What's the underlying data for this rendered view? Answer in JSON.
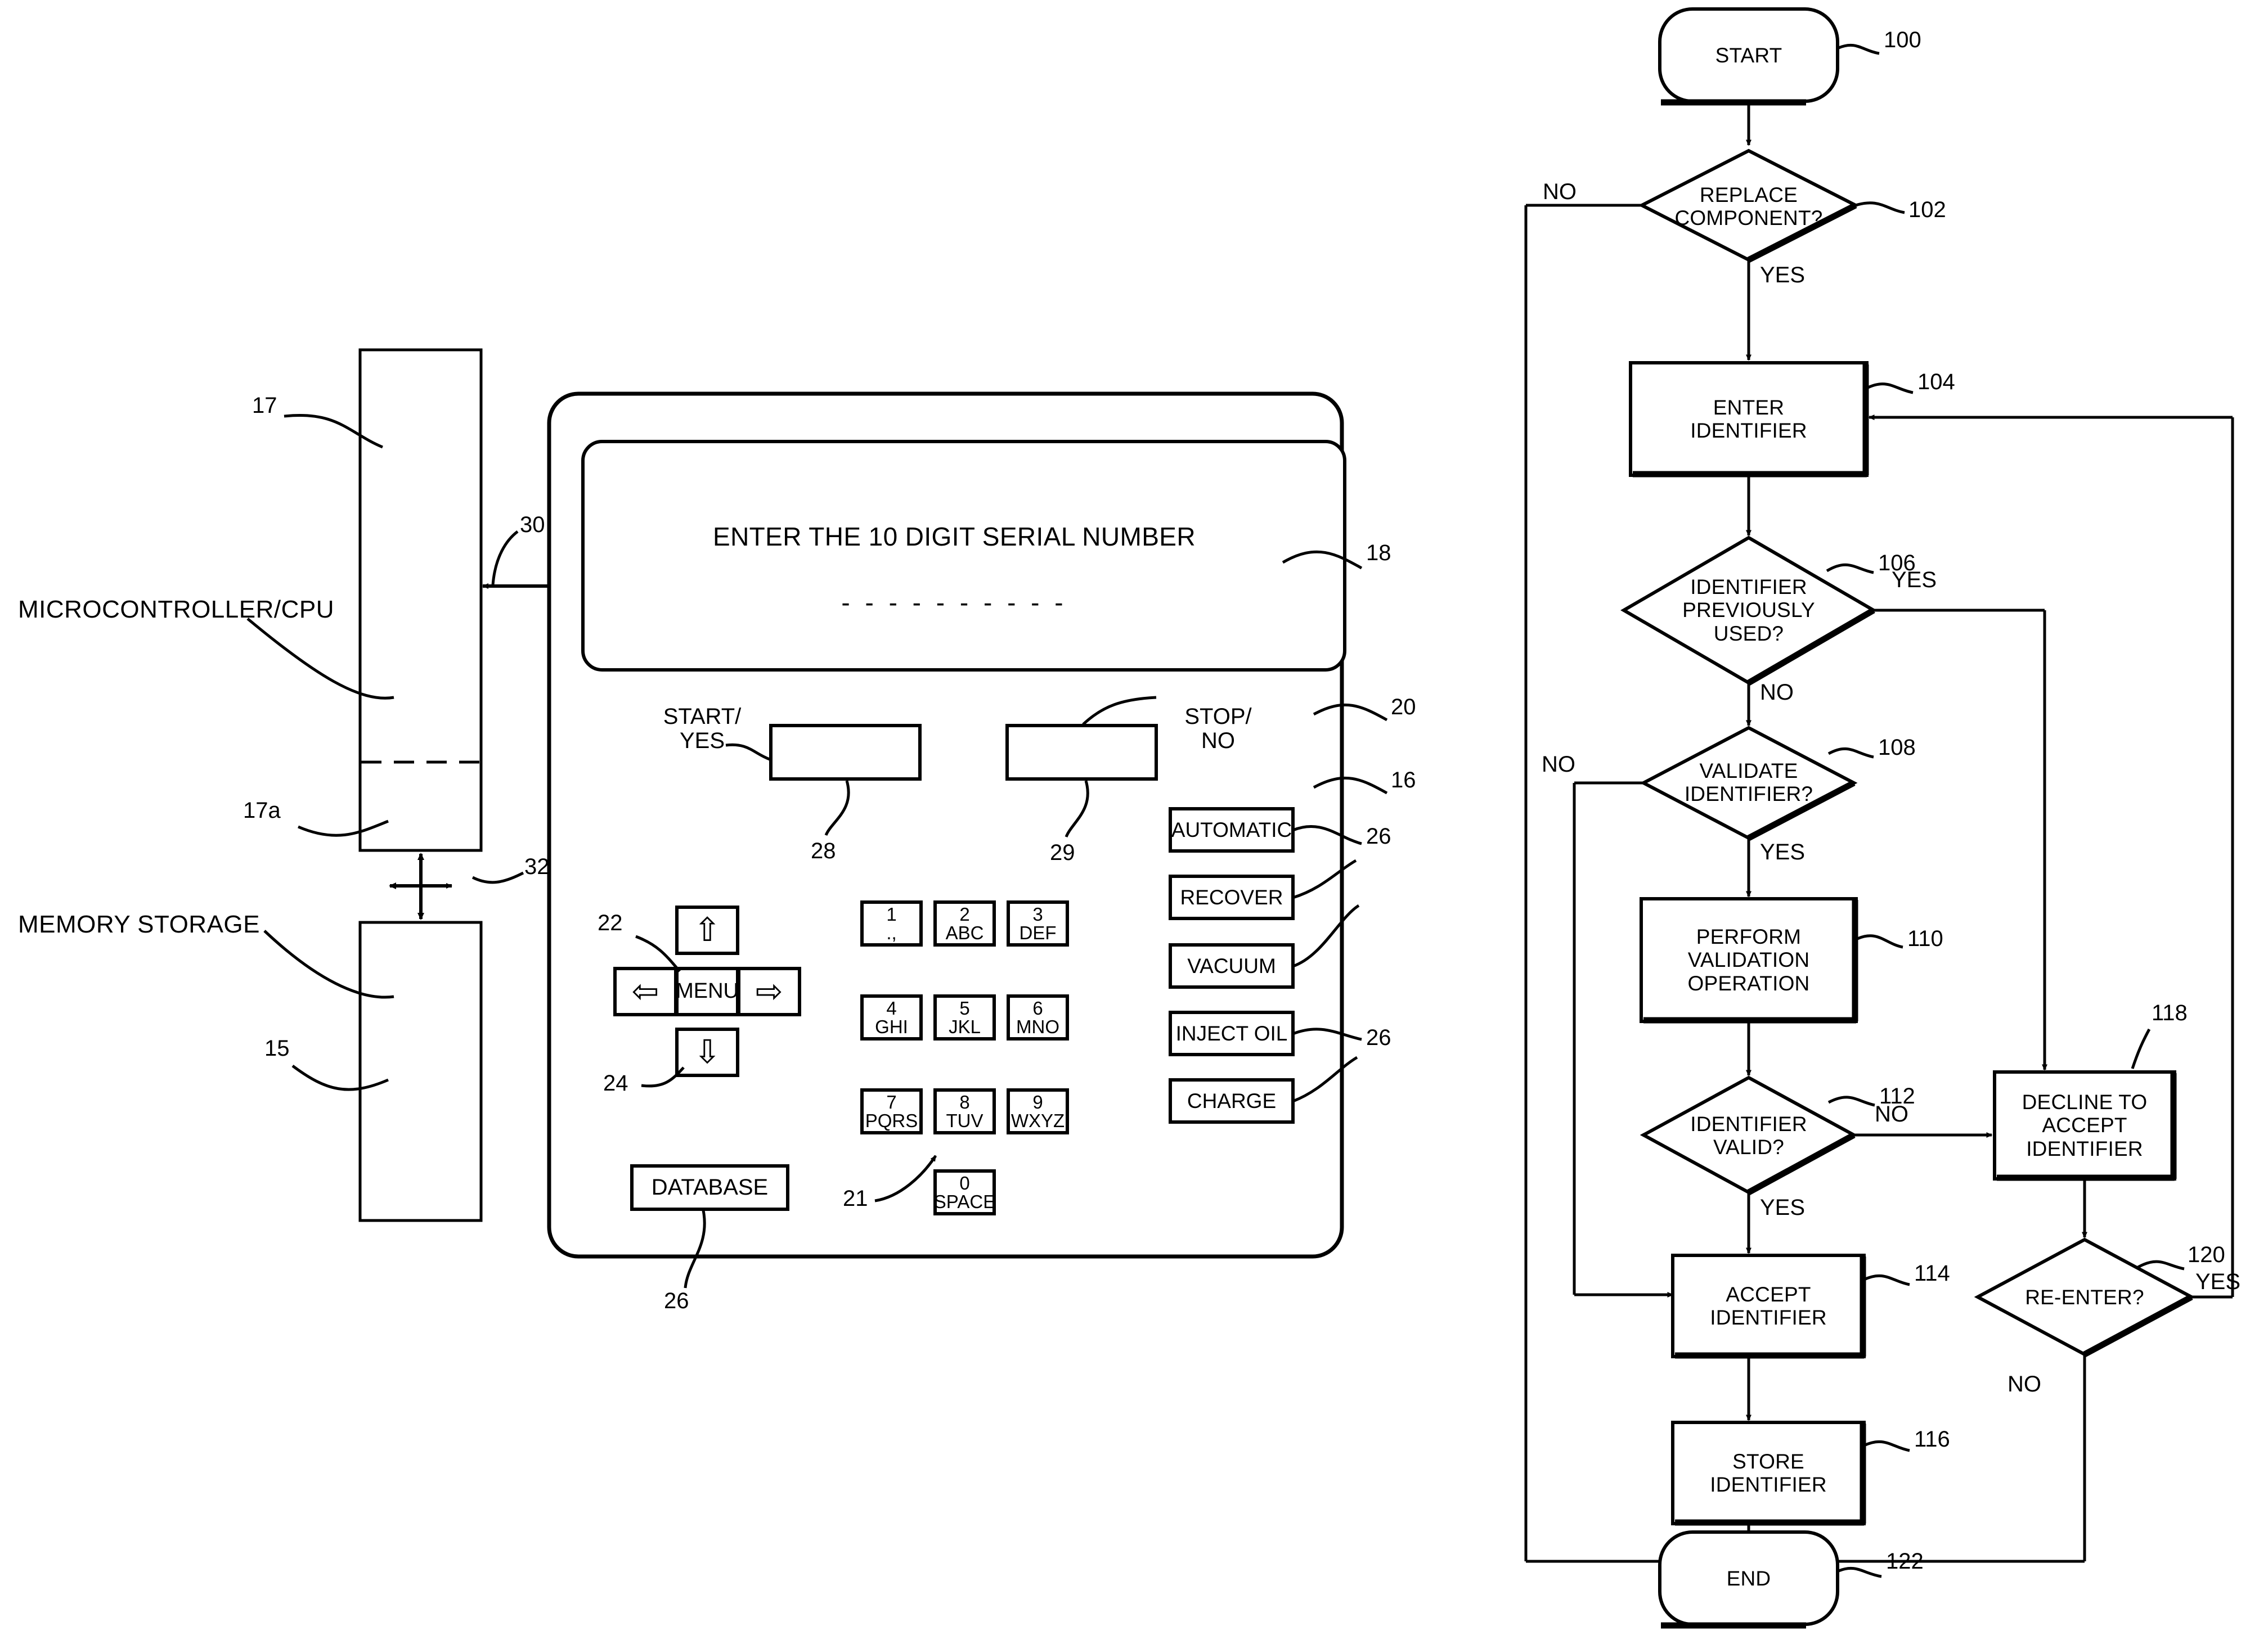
{
  "figure": {
    "type": "patent-diagram",
    "left_system_block": {
      "labels": [
        {
          "id": "microcontroller",
          "text": "MICROCONTROLLER/CPU",
          "ref": "17"
        },
        {
          "id": "memory",
          "text": "MEMORY STORAGE",
          "ref": "15"
        }
      ],
      "refs": {
        "cpu": "17",
        "cpu_lower": "17a",
        "memory": "15",
        "bus_cpu_device": "30",
        "bus_cpu_memory": "32"
      }
    },
    "device": {
      "refs": {
        "housing": "16",
        "display": "18",
        "panel": "20",
        "keypad": "21",
        "arrow_pad": "22",
        "down_arrow": "24",
        "function_keys": "26",
        "start_key": "28",
        "stop_key": "29"
      },
      "display": {
        "prompt": "ENTER THE 10 DIGIT SERIAL NUMBER",
        "entry_mask": "- - - - - - - - - -"
      },
      "start_button": {
        "label": "START/\nYES",
        "ref": "28"
      },
      "stop_button": {
        "label": "STOP/\nNO",
        "ref": "29"
      },
      "nav_keys": [
        {
          "name": "up-arrow-key",
          "glyph": "⇧"
        },
        {
          "name": "left-arrow-key",
          "glyph": "⇦"
        },
        {
          "name": "menu-key",
          "label": "MENU"
        },
        {
          "name": "right-arrow-key",
          "glyph": "⇨"
        },
        {
          "name": "down-arrow-key",
          "glyph": "⇩"
        }
      ],
      "database_key": {
        "label": "DATABASE",
        "ref": "26"
      },
      "keypad": [
        {
          "digit": "1",
          "letters": ".,"
        },
        {
          "digit": "2",
          "letters": "ABC"
        },
        {
          "digit": "3",
          "letters": "DEF"
        },
        {
          "digit": "4",
          "letters": "GHI"
        },
        {
          "digit": "5",
          "letters": "JKL"
        },
        {
          "digit": "6",
          "letters": "MNO"
        },
        {
          "digit": "7",
          "letters": "PQRS"
        },
        {
          "digit": "8",
          "letters": "TUV"
        },
        {
          "digit": "9",
          "letters": "WXYZ"
        },
        {
          "digit": "0",
          "letters": "SPACE"
        }
      ],
      "function_keys": [
        {
          "label": "AUTOMATIC",
          "ref": "26"
        },
        {
          "label": "RECOVER",
          "ref": ""
        },
        {
          "label": "VACUUM",
          "ref": "26"
        },
        {
          "label": "INJECT OIL",
          "ref": "26"
        },
        {
          "label": "CHARGE",
          "ref": "26"
        }
      ]
    },
    "flowchart": {
      "nodes": [
        {
          "ref": "100",
          "shape": "terminator",
          "text": "START"
        },
        {
          "ref": "102",
          "shape": "decision",
          "text": "REPLACE\nCOMPONENT?"
        },
        {
          "ref": "104",
          "shape": "process",
          "text": "ENTER\nIDENTIFIER"
        },
        {
          "ref": "106",
          "shape": "decision",
          "text": "IDENTIFIER\nPREVIOUSLY\nUSED?"
        },
        {
          "ref": "108",
          "shape": "decision",
          "text": "VALIDATE\nIDENTIFIER?"
        },
        {
          "ref": "110",
          "shape": "process",
          "text": "PERFORM\nVALIDATION\nOPERATION"
        },
        {
          "ref": "112",
          "shape": "decision",
          "text": "IDENTIFIER\nVALID?"
        },
        {
          "ref": "114",
          "shape": "process",
          "text": "ACCEPT\nIDENTIFIER"
        },
        {
          "ref": "116",
          "shape": "process",
          "text": "STORE\nIDENTIFIER"
        },
        {
          "ref": "118",
          "shape": "process",
          "text": "DECLINE TO\nACCEPT\nIDENTIFIER"
        },
        {
          "ref": "120",
          "shape": "decision",
          "text": "RE-ENTER?"
        },
        {
          "ref": "122",
          "shape": "terminator",
          "text": "END"
        }
      ],
      "branch_labels": [
        {
          "id": "b102-no",
          "text": "NO"
        },
        {
          "id": "b102-yes",
          "text": "YES"
        },
        {
          "id": "b106-yes",
          "text": "YES"
        },
        {
          "id": "b106-no",
          "text": "NO"
        },
        {
          "id": "b108-no",
          "text": "NO"
        },
        {
          "id": "b108-yes",
          "text": "YES"
        },
        {
          "id": "b112-no",
          "text": "NO"
        },
        {
          "id": "b112-yes",
          "text": "YES"
        },
        {
          "id": "b120-yes",
          "text": "YES"
        },
        {
          "id": "b120-no",
          "text": "NO"
        }
      ]
    }
  }
}
